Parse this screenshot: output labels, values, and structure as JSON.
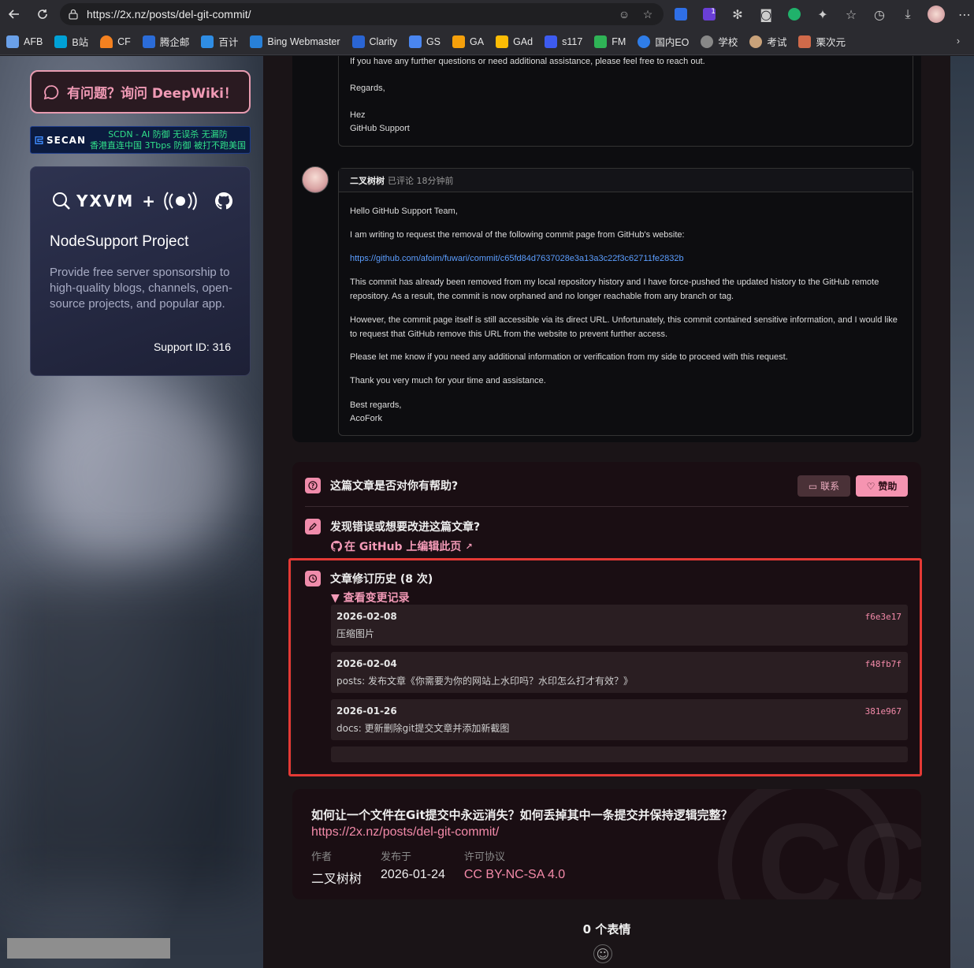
{
  "browser": {
    "url": "https://2x.nz/posts/del-git-commit/",
    "bookmarks": [
      "AFB",
      "B站",
      "CF",
      "腾企邮",
      "百计",
      "Bing Webmaster",
      "Clarity",
      "GS",
      "GA",
      "GAd",
      "s117",
      "FM",
      "国内EO",
      "学校",
      "考试",
      "栗次元"
    ],
    "extension_badge": "1"
  },
  "sidebar": {
    "ask_button": "有问题？询问 DeepWiki！",
    "secan": {
      "logo": "SECAN",
      "line1": "SCDN - AI 防御 无误杀 无漏防",
      "line2": "香港直连中国 3Tbps 防御 被打不跑美国"
    },
    "node_card": {
      "logo_text": "YXVM",
      "plus": "+",
      "title": "NodeSupport Project",
      "description": "Provide free server sponsorship to high-quality blogs, channels, open-source projects, and popular app.",
      "support_id": "Support ID: 316"
    }
  },
  "email": {
    "prev": {
      "line1": "If you have any further questions or need additional assistance, please feel free to reach out.",
      "regards": "Regards,",
      "name": "Hez",
      "team": "GitHub Support"
    },
    "reply": {
      "author": "二叉树树",
      "meta": "已评论 18分钟前",
      "greeting": "Hello GitHub Support Team,",
      "p1": "I am writing to request the removal of the following commit page from GitHub's website:",
      "link": "https://github.com/afoim/fuwari/commit/c65fd84d7637028e3a13a3c22f3c62711fe2832b",
      "p2": "This commit has already been removed from my local repository history and I have force-pushed the updated history to the GitHub remote repository. As a result, the commit is now orphaned and no longer reachable from any branch or tag.",
      "p3": "However, the commit page itself is still accessible via its direct URL. Unfortunately, this commit contained sensitive information, and I would like to request that GitHub remove this URL from the website to prevent further access.",
      "p4": "Please let me know if you need any additional information or verification from my side to proceed with this request.",
      "p5": "Thank you very much for your time and assistance.",
      "closing": "Best regards,",
      "signature": "AcoFork"
    }
  },
  "feedback": {
    "helpful_q": "这篇文章是否对你有帮助?",
    "contact_btn": "联系",
    "sponsor_btn": "赞助",
    "improve_q": "发现错误或想要改进这篇文章?",
    "edit_link": "在 GitHub 上编辑此页",
    "history_title": "文章修订历史 (8 次)",
    "history_toggle": "▼ 查看变更记录",
    "commits": [
      {
        "date": "2026-02-08",
        "msg": "压缩图片",
        "hash": "f6e3e17"
      },
      {
        "date": "2026-02-04",
        "msg": "posts: 发布文章《你需要为你的网站上水印吗？水印怎么打才有效？》",
        "hash": "f48fb7f"
      },
      {
        "date": "2026-01-26",
        "msg": "docs: 更新删除git提交文章并添加新截图",
        "hash": "381e967"
      }
    ]
  },
  "license": {
    "title": "如何让一个文件在Git提交中永远消失？如何丢掉其中一条提交并保持逻辑完整？",
    "url": "https://2x.nz/posts/del-git-commit/",
    "author_label": "作者",
    "author": "二叉树树",
    "published_label": "发布于",
    "published": "2026-01-24",
    "license_label": "许可协议",
    "license": "CC BY-NC-SA 4.0",
    "watermark": "CC"
  },
  "reactions": "0 个表情"
}
